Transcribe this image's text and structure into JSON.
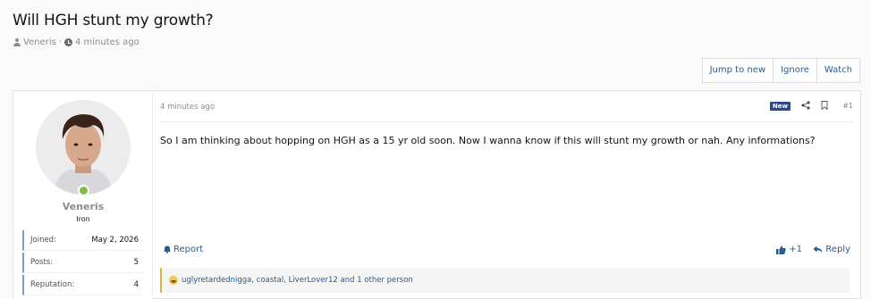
{
  "thread": {
    "title": "Will HGH stunt my growth?",
    "author": "Veneris",
    "separator": "·",
    "time": "4 minutes ago"
  },
  "actions": {
    "jump_to_new": "Jump to new",
    "ignore": "Ignore",
    "watch": "Watch"
  },
  "user": {
    "name": "Veneris",
    "title": "Iron",
    "online": true,
    "stats": [
      {
        "label": "Joined:",
        "value": "May 2, 2026"
      },
      {
        "label": "Posts:",
        "value": "5"
      },
      {
        "label": "Reputation:",
        "value": "4"
      }
    ]
  },
  "post": {
    "date": "4 minutes ago",
    "badge": "New",
    "number": "#1",
    "message": "So I am thinking about hopping on HGH as a 15 yr old soon. Now I wanna know if this will stunt my growth or nah. Any informations?",
    "report_label": "Report",
    "like_count": "+1",
    "reply_label": "Reply",
    "reactions_text": "uglyretardednigga, coastal, LiverLover12 and 1 other person"
  },
  "colors": {
    "link": "#2b5a8a",
    "badge": "#2c4a8a",
    "online": "#7bc043",
    "reaction_accent": "#e8b33a"
  }
}
